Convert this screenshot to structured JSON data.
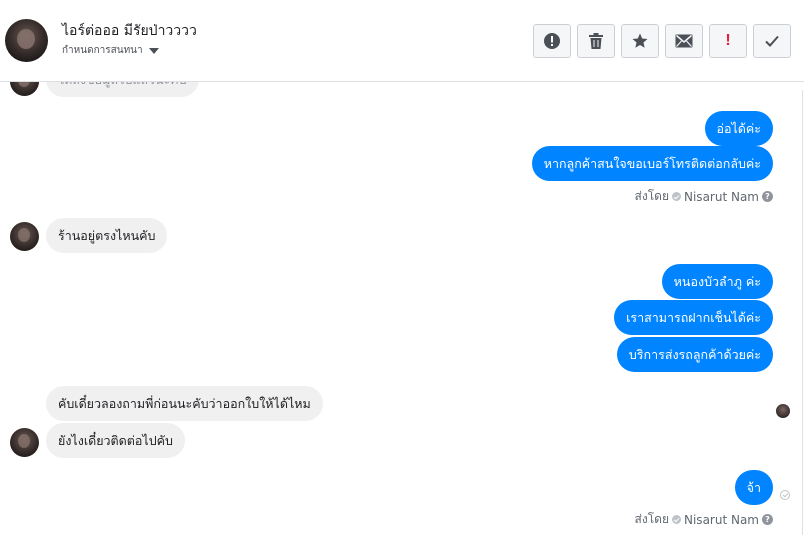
{
  "header": {
    "name": "ไอร์ต่อออ มีรัยป่าวววว",
    "sub_label": "กำหนดการสนทนา"
  },
  "toolbar": {
    "buttons": [
      {
        "name": "report-button",
        "icon": "alert-circle-icon"
      },
      {
        "name": "delete-button",
        "icon": "trash-icon"
      },
      {
        "name": "star-button",
        "icon": "star-icon"
      },
      {
        "name": "mark-unread-button",
        "icon": "envelope-icon"
      },
      {
        "name": "spam-button",
        "icon": "exclamation-icon",
        "label": "!"
      },
      {
        "name": "done-button",
        "icon": "check-icon"
      }
    ]
  },
  "messages": {
    "partial_in": "ได้ส่งข้อมูลไปแล้วนะคับ",
    "out1": "อ่อได้ค่ะ",
    "out2": "หากลูกค้าสนใจขอเบอร์โทรติดต่อกลับค่ะ",
    "in1": "ร้านอยู่ตรงไหนคับ",
    "out3": "หนองบัวลำภู ค่ะ",
    "out4": "เราสามารถฝากเช็นได้ค่ะ",
    "out5": "บริการส่งรถลูกค้าด้วยค่ะ",
    "in2": "คับเดี๋ยวลองถามพี่ก่อนนะคับว่าออกใบให้ได้ไหม",
    "in3": "ยังไงเดี๋ยวติดต่อไปคับ",
    "out6": "จ้า"
  },
  "sent_by": {
    "prefix": "ส่งโดย",
    "name": "Nisarut Nam",
    "help": "?"
  },
  "colors": {
    "outgoing_bubble": "#0084ff",
    "incoming_bubble": "#f1f0f0"
  }
}
